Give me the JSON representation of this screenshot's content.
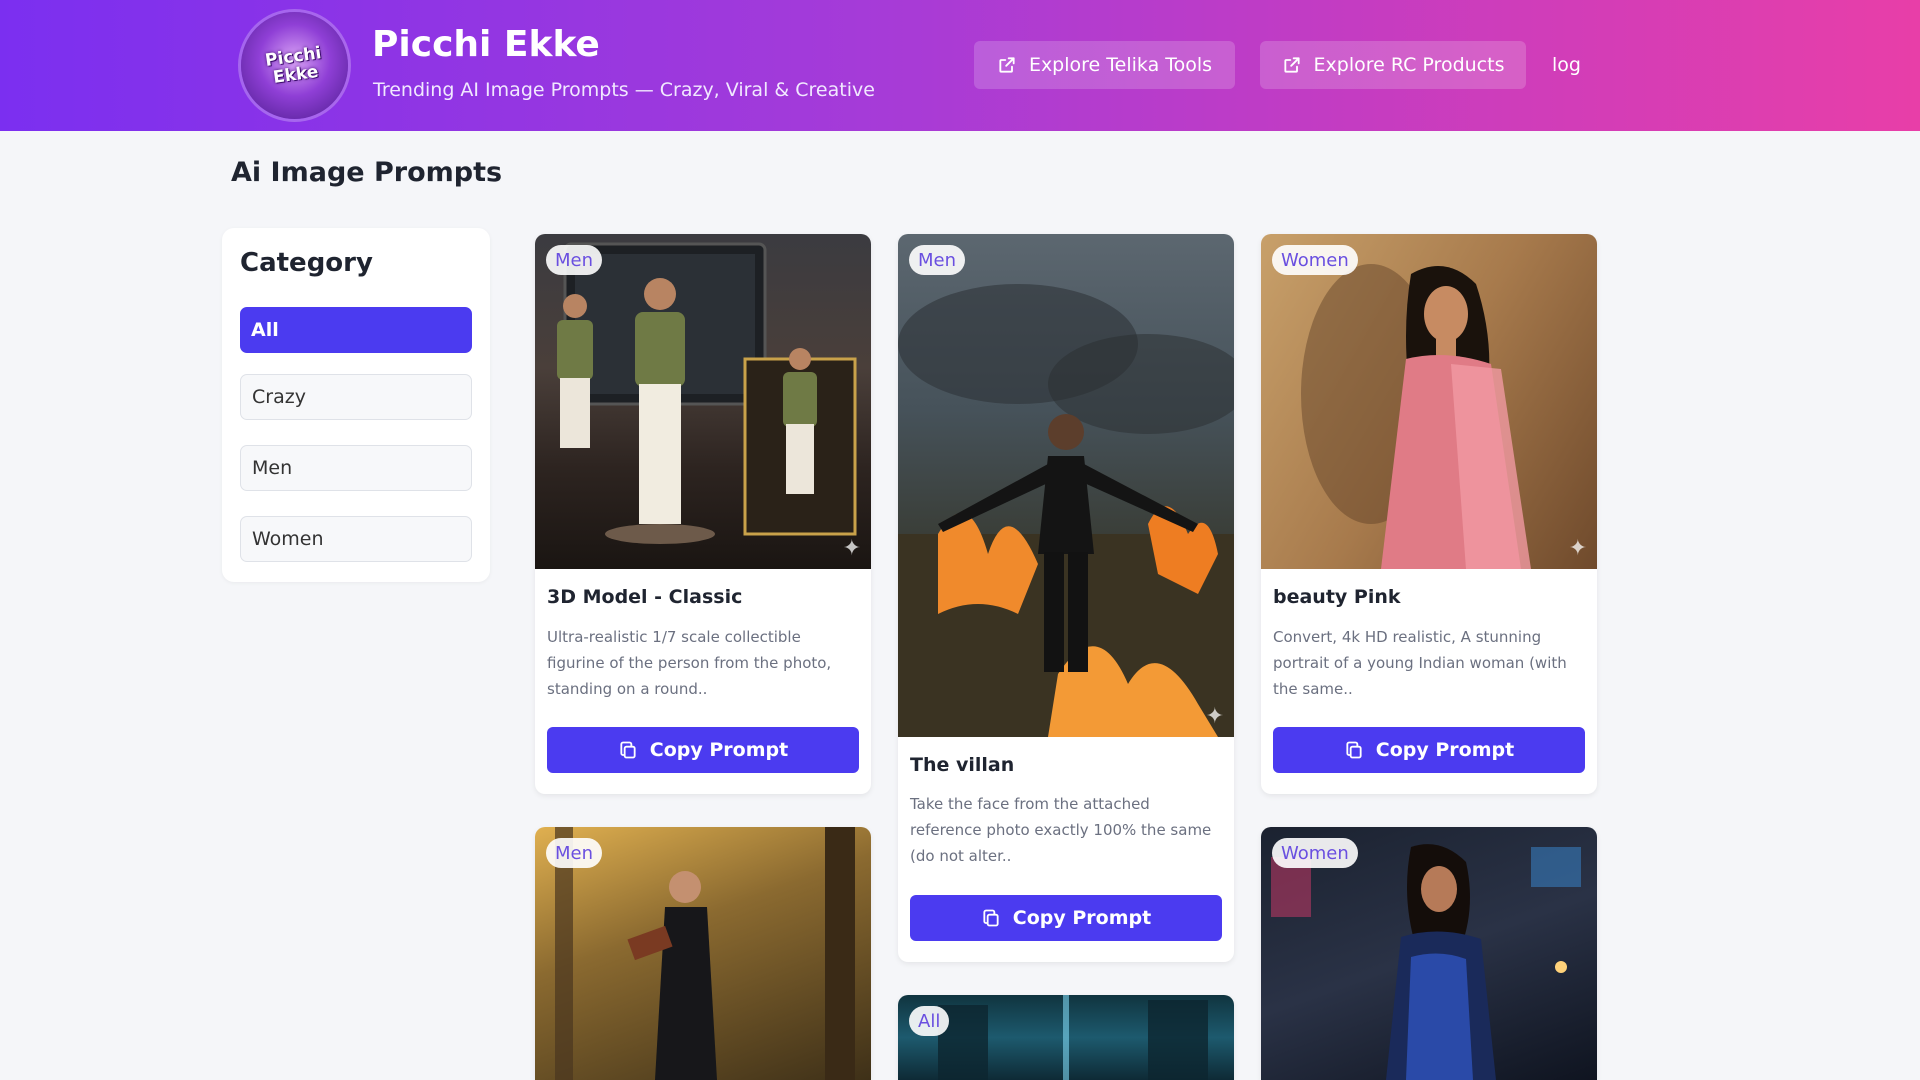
{
  "header": {
    "logo_text": "Picchi Ekke",
    "title": "Picchi Ekke",
    "subtitle": "Trending AI Image Prompts — Crazy, Viral & Creative",
    "button1": "Explore Telika Tools",
    "button2": "Explore RC Products",
    "link": "log",
    "gradient": [
      "#7b2ff0",
      "#e83ea8"
    ]
  },
  "page_title": "Ai Image Prompts",
  "sidebar": {
    "title": "Category",
    "items": [
      {
        "label": "All",
        "active": true
      },
      {
        "label": "Crazy",
        "active": false
      },
      {
        "label": "Men",
        "active": false
      },
      {
        "label": "Women",
        "active": false
      }
    ]
  },
  "accent": "#4b3bf0",
  "cards": [
    {
      "badge": "Men",
      "title": "3D Model - Classic",
      "desc": "Ultra-realistic 1/7 scale collectible figurine of the person from the photo, standing on a round..",
      "button": "Copy Prompt"
    },
    {
      "badge": "Men",
      "title": "The villan",
      "desc": "Take the face from the attached reference photo exactly 100% the same (do not alter..",
      "button": "Copy Prompt"
    },
    {
      "badge": "Women",
      "title": "beauty Pink",
      "desc": "Convert, 4k HD realistic, A stunning portrait of a young Indian woman (with the same..",
      "button": "Copy Prompt"
    },
    {
      "badge": "Men"
    },
    {
      "badge": "All"
    },
    {
      "badge": "Women"
    }
  ]
}
